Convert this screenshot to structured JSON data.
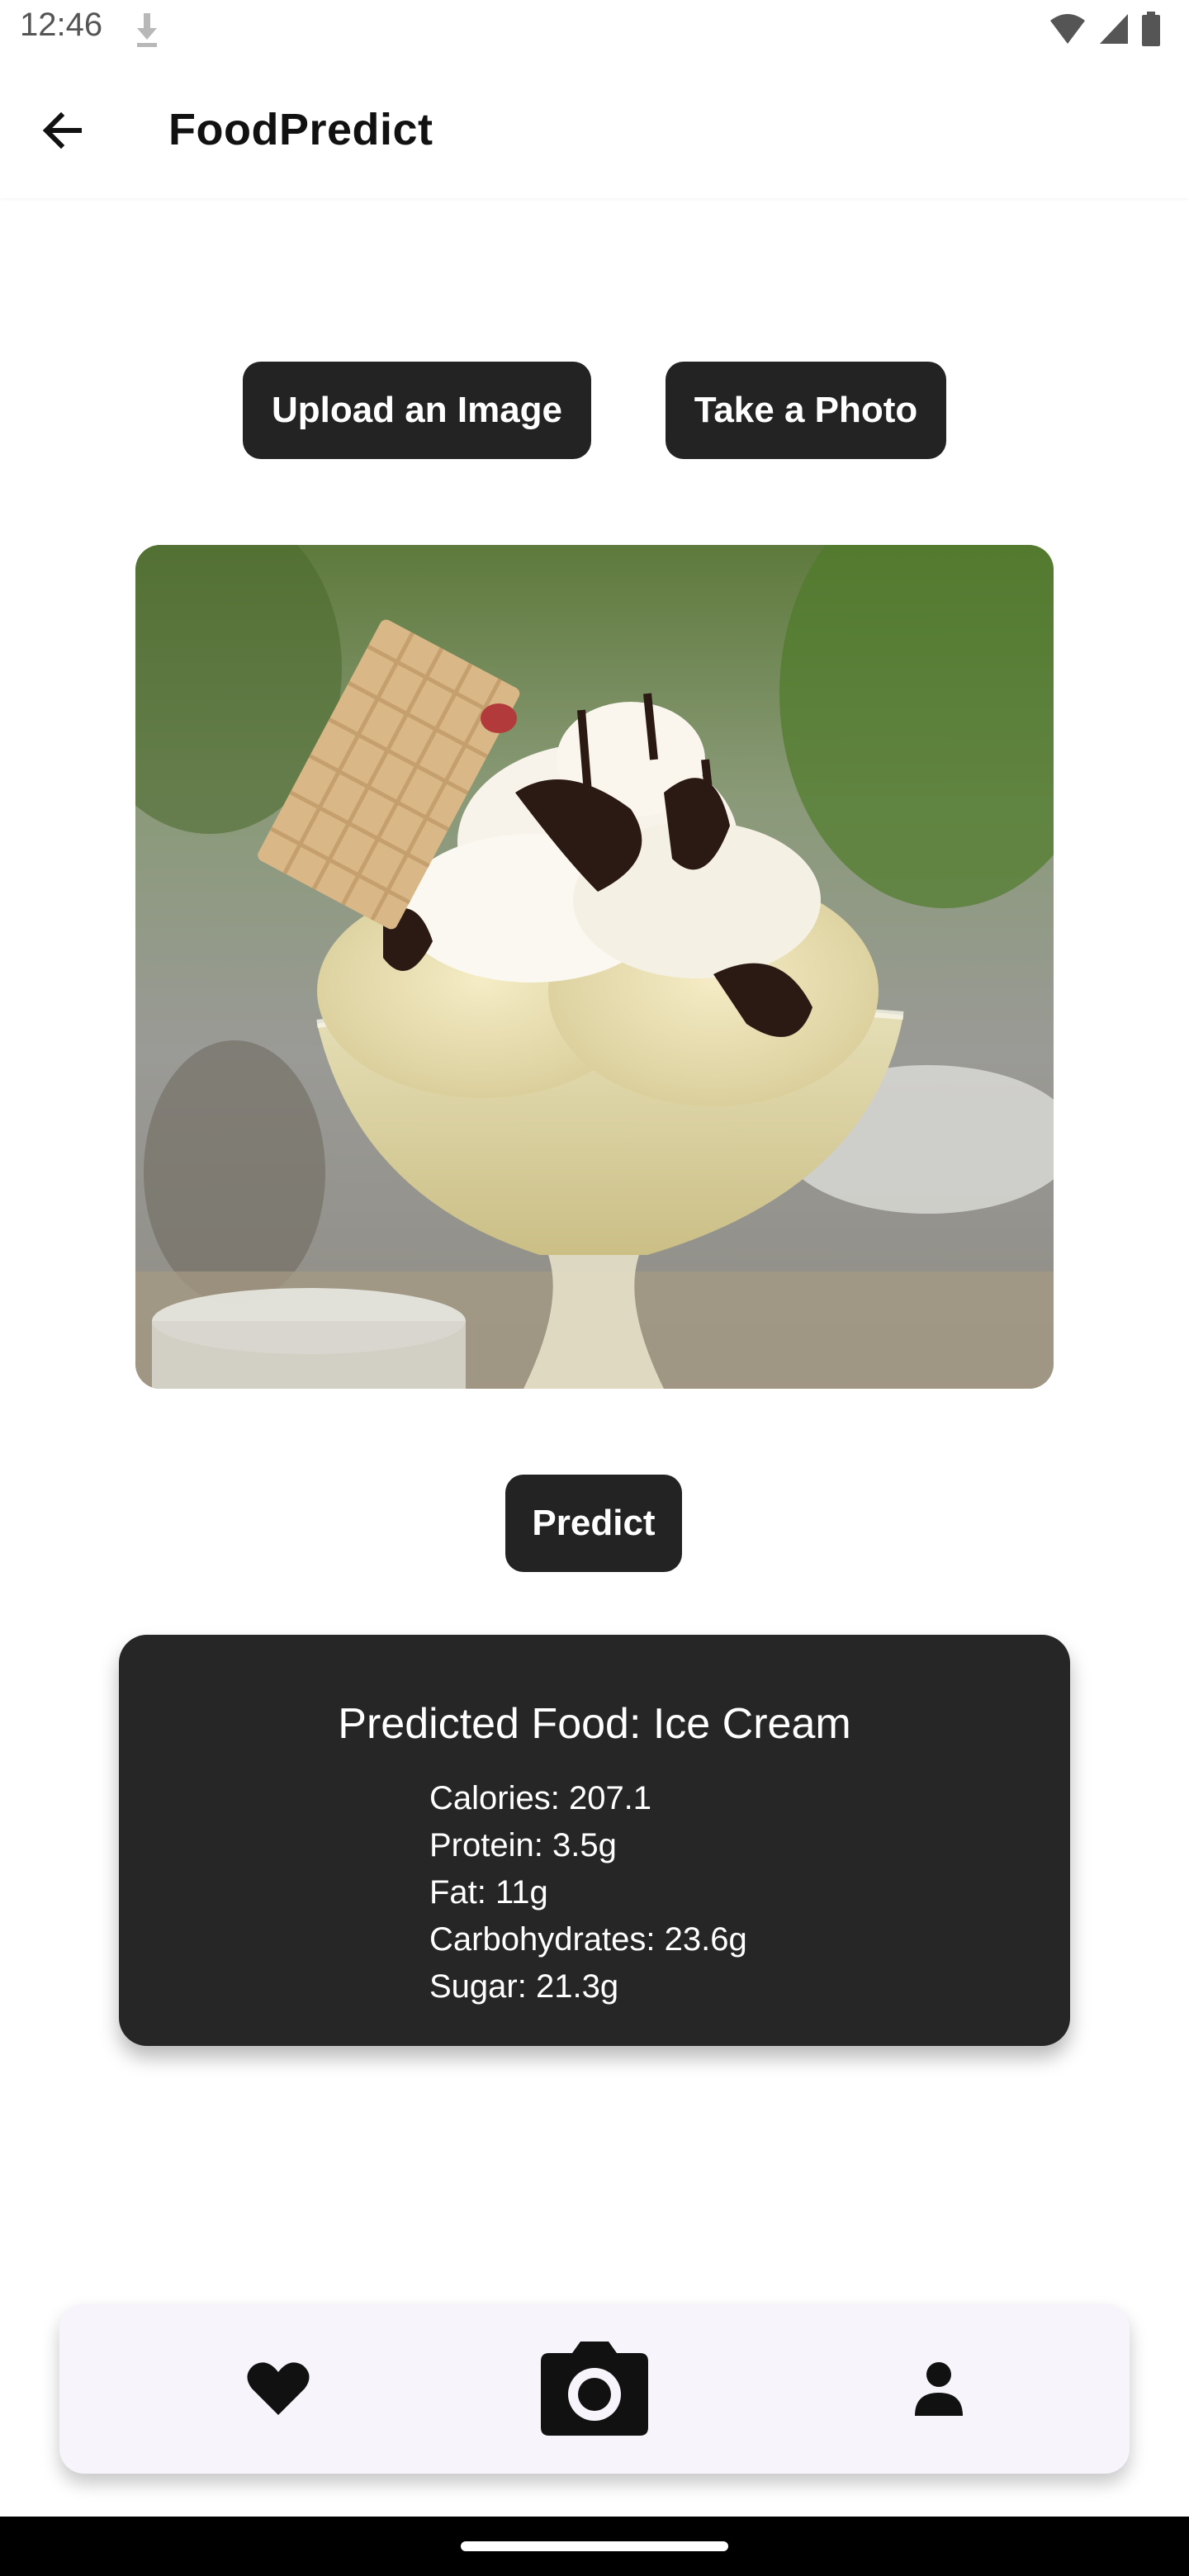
{
  "status_bar": {
    "time": "12:46",
    "icons": [
      "download-icon",
      "wifi-icon",
      "signal-icon",
      "battery-icon"
    ]
  },
  "app_bar": {
    "title": "FoodPredict",
    "back_icon": "arrow-left-icon"
  },
  "actions": {
    "upload_label": "Upload an Image",
    "photo_label": "Take a Photo",
    "predict_label": "Predict"
  },
  "image": {
    "description_icon": "food-photo"
  },
  "result": {
    "title": "Predicted Food: Ice Cream",
    "nutrition": [
      "Calories: 207.1",
      "Protein: 3.5g",
      "Fat: 11g",
      "Carbohydrates: 23.6g",
      "Sugar: 21.3g"
    ]
  },
  "bottom_nav": {
    "items": [
      "heart-icon",
      "camera-icon",
      "person-icon"
    ]
  },
  "colors": {
    "button_bg": "#232323",
    "card_bg": "#262626",
    "nav_bg": "#f7f5fb"
  }
}
